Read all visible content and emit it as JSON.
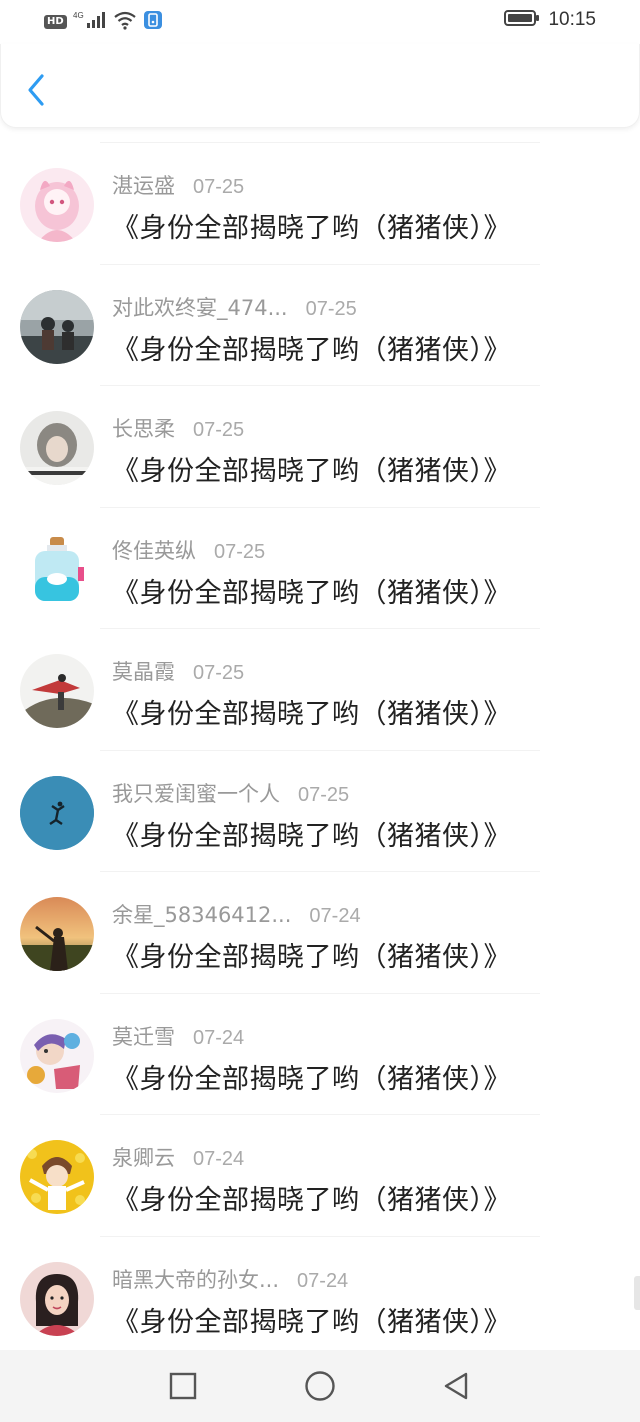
{
  "status_bar": {
    "hd_badge": "HD",
    "network": "4G",
    "time": "10:15",
    "icons": [
      "hd-icon",
      "signal-icon",
      "wifi-icon",
      "app-notification-icon",
      "battery-icon"
    ]
  },
  "nav": {
    "back_icon": "chevron-left-icon"
  },
  "accent_color": "#2e9cf2",
  "items": [
    {
      "name": "湛运盛",
      "date": "07-25",
      "title": "《身份全部揭晓了哟（猪猪侠）》",
      "avatar": "anime-girl-pink"
    },
    {
      "name": "对此欢终宴_474...",
      "date": "07-25",
      "title": "《身份全部揭晓了哟（猪猪侠）》",
      "avatar": "couple-photo"
    },
    {
      "name": "长思柔",
      "date": "07-25",
      "title": "《身份全部揭晓了哟（猪猪侠）》",
      "avatar": "hooded-figure"
    },
    {
      "name": "佟佳英纵",
      "date": "07-25",
      "title": "《身份全部揭晓了哟（猪猪侠）》",
      "avatar": "whale-bottle"
    },
    {
      "name": "莫晶霞",
      "date": "07-25",
      "title": "《身份全部揭晓了哟（猪猪侠）》",
      "avatar": "warrior-scene"
    },
    {
      "name": "我只爱闺蜜一个人",
      "date": "07-25",
      "title": "《身份全部揭晓了哟（猪猪侠）》",
      "avatar": "falling-figure-blue"
    },
    {
      "name": "余星_58346412...",
      "date": "07-24",
      "title": "《身份全部揭晓了哟（猪猪侠）》",
      "avatar": "sunset-girl"
    },
    {
      "name": "莫迁雪",
      "date": "07-24",
      "title": "《身份全部揭晓了哟（猪猪侠）》",
      "avatar": "colorful-anime"
    },
    {
      "name": "泉卿云",
      "date": "07-24",
      "title": "《身份全部揭晓了哟（猪猪侠）》",
      "avatar": "yellow-flowers-anime"
    },
    {
      "name": "暗黑大帝的孙女...",
      "date": "07-24",
      "title": "《身份全部揭晓了哟（猪猪侠）》",
      "avatar": "girl-portrait"
    }
  ],
  "system_nav": {
    "icons": [
      "square-recents-icon",
      "circle-home-icon",
      "triangle-back-icon"
    ]
  }
}
